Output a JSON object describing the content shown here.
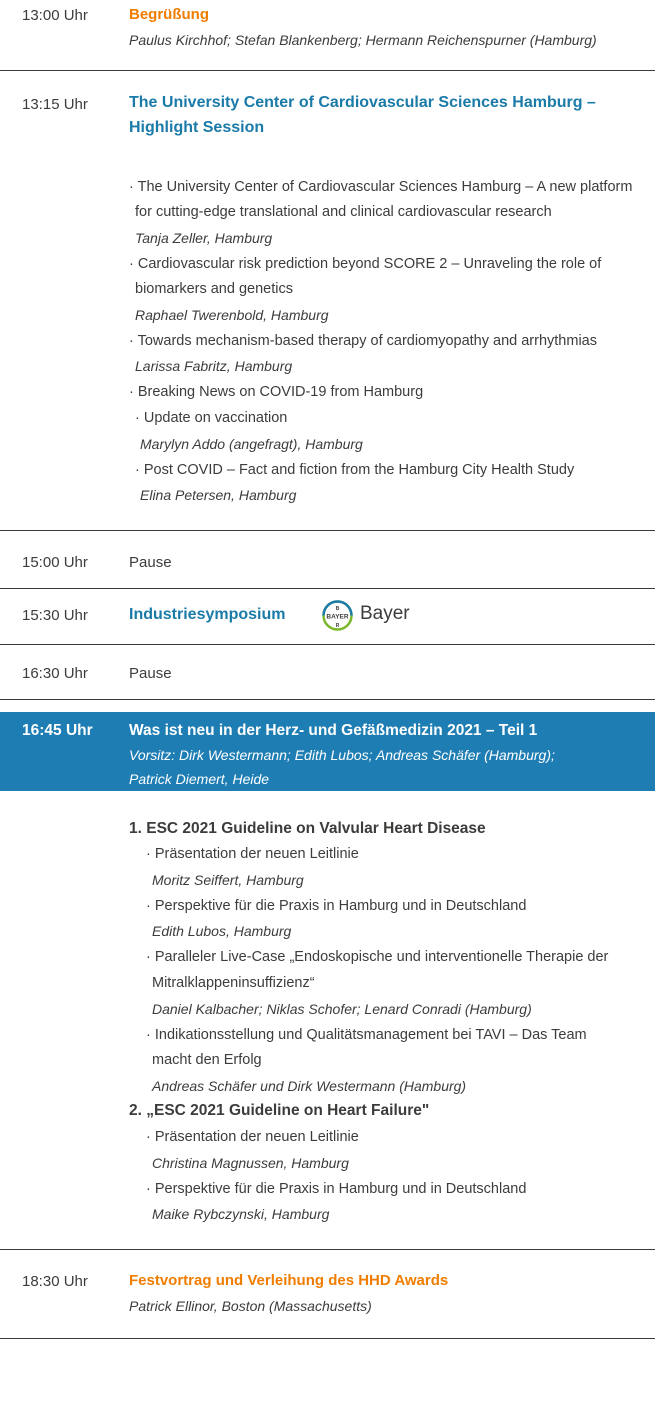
{
  "colors": {
    "orange": "#f07d00",
    "blue": "#1a7aa8",
    "highlight_bg": "#1e7eb4",
    "text": "#3c3c3b"
  },
  "s1": {
    "time": "13:00 Uhr",
    "title": "Begrüßung",
    "speakers": "Paulus Kirchhof; Stefan Blankenberg; Hermann Reichenspurner (Hamburg)"
  },
  "s2": {
    "time": "13:15 Uhr",
    "title_line1": "The University Center of Cardiovascular Sciences Hamburg –",
    "title_line2": "Highlight Session",
    "items": [
      {
        "line1": "· The University Center of Cardiovascular Sciences Hamburg – A new platform",
        "line2": "for cutting-edge translational and clinical cardiovascular research",
        "speaker": "Tanja Zeller, Hamburg"
      },
      {
        "line1": "· Cardiovascular risk prediction beyond SCORE 2 – Unraveling the role of",
        "line2": "biomarkers and genetics",
        "speaker": "Raphael Twerenbold, Hamburg"
      },
      {
        "line1": "· Towards mechanism-based therapy of cardiomyopathy and arrhythmias",
        "speaker": "Larissa Fabritz, Hamburg"
      },
      {
        "line1": "· Breaking News on COVID-19 from Hamburg"
      }
    ],
    "subitems": [
      {
        "line1": "· Update on vaccination",
        "speaker": "Marylyn Addo (angefragt), Hamburg"
      },
      {
        "line1": "· Post COVID – Fact and fiction from the Hamburg City Health Study",
        "speaker": "Elina Petersen, Hamburg"
      }
    ]
  },
  "s3": {
    "time": "15:00 Uhr",
    "title": "Pause"
  },
  "s4": {
    "time": "15:30 Uhr",
    "title": "Industriesymposium",
    "sponsor": "Bayer",
    "logo_text": "BAYER"
  },
  "s5": {
    "time": "16:30 Uhr",
    "title": "Pause"
  },
  "s6": {
    "time": "16:45 Uhr",
    "title": "Was ist neu in der Herz- und Gefäßmedizin 2021 – Teil 1",
    "chair_line1": "Vorsitz: Dirk Westermann; Edith Lubos; Andreas Schäfer (Hamburg);",
    "chair_line2": "Patrick Diemert, Heide"
  },
  "s7": {
    "block1_title": "1. ESC 2021 Guideline on Valvular Heart Disease",
    "block1": [
      {
        "line1": "· Präsentation der neuen Leitlinie",
        "speaker": "Moritz Seiffert, Hamburg"
      },
      {
        "line1": "· Perspektive für die Praxis in Hamburg und in Deutschland",
        "speaker": "Edith Lubos, Hamburg"
      },
      {
        "line1": "· Paralleler Live-Case „Endoskopische und interventionelle Therapie der",
        "line2": "Mitralklappeninsuffizienz“",
        "speaker": "Daniel Kalbacher; Niklas Schofer; Lenard Conradi (Hamburg)"
      },
      {
        "line1": "· Indikationsstellung und Qualitätsmanagement bei TAVI – Das Team",
        "line2": "macht den Erfolg",
        "speaker": "Andreas Schäfer und Dirk Westermann (Hamburg)"
      }
    ],
    "block2_title": "2. „ESC 2021 Guideline on Heart Failure\"",
    "block2": [
      {
        "line1": "· Präsentation der neuen Leitlinie",
        "speaker": "Christina Magnussen, Hamburg"
      },
      {
        "line1": "· Perspektive für die Praxis in Hamburg und in Deutschland",
        "speaker": "Maike Rybczynski, Hamburg"
      }
    ]
  },
  "s8": {
    "time": "18:30 Uhr",
    "title": "Festvortrag und Verleihung des HHD Awards",
    "speakers": "Patrick Ellinor, Boston (Massachusetts)"
  }
}
